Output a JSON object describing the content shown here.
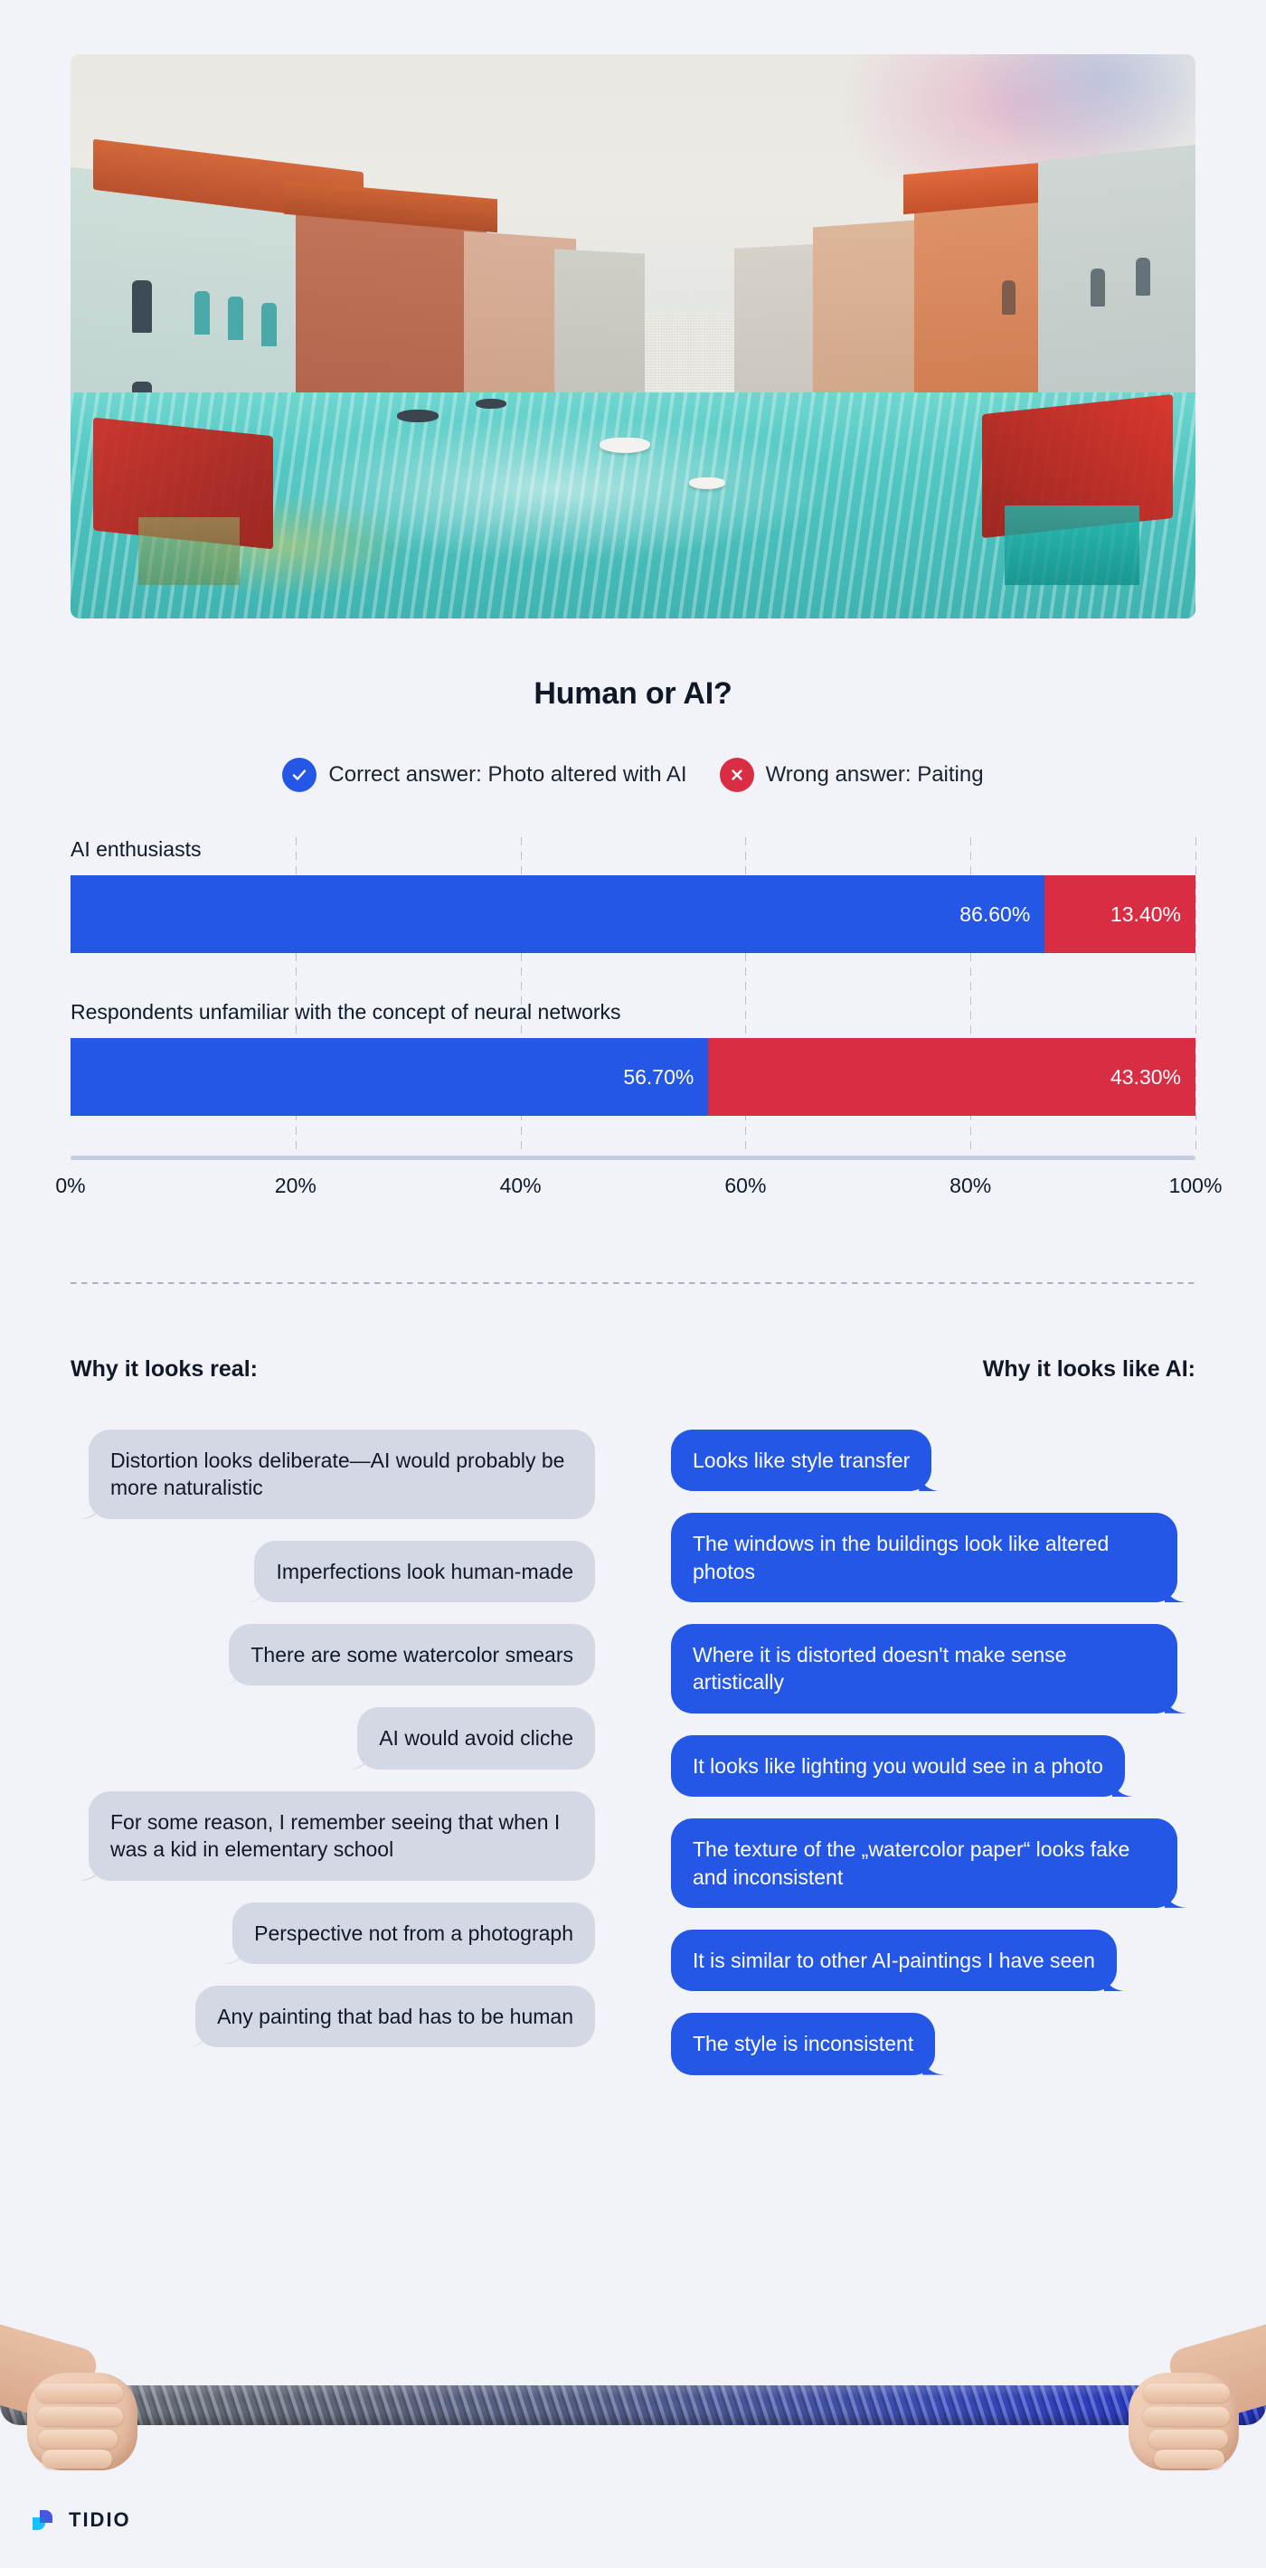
{
  "hero": {
    "alt": "watercolor-painting-of-venice-canal-with-boats"
  },
  "headline": "Human or AI?",
  "legend": [
    {
      "icon": "check-circle-icon",
      "label": "Correct answer: Photo altered with AI",
      "color": "#2457e6"
    },
    {
      "icon": "x-circle-icon",
      "label": "Wrong answer: Paiting",
      "color": "#d92d43"
    }
  ],
  "chart_data": {
    "type": "bar",
    "title": "Human or AI?",
    "orientation": "horizontal",
    "stacked": true,
    "categories": [
      "AI enthusiasts",
      "Respondents unfamiliar with the concept of neural networks"
    ],
    "series": [
      {
        "name": "Correct answer: Photo altered with AI",
        "color": "#2457e6",
        "values": [
          86.6,
          56.7
        ],
        "labels": [
          "86.60%",
          "56.70%"
        ]
      },
      {
        "name": "Wrong answer: Paiting",
        "color": "#d92d43",
        "values": [
          13.4,
          43.3
        ],
        "labels": [
          "13.40%",
          "43.30%"
        ]
      }
    ],
    "xlabel": "",
    "ylabel": "",
    "xlim": [
      0,
      100
    ],
    "xticks": [
      0,
      20,
      40,
      60,
      80,
      100
    ],
    "xtick_labels": [
      "0%",
      "20%",
      "40%",
      "60%",
      "80%",
      "100%"
    ],
    "grid": true,
    "grid_style": "dashed-vertical",
    "legend_position": "top-center"
  },
  "columns": {
    "left": {
      "heading": "Why it looks real:",
      "quotes": [
        "Distortion looks deliberate—AI would probably be more naturalistic",
        "Imperfections look human-made",
        "There are some watercolor smears",
        "AI would avoid cliche",
        "For some reason, I remember seeing that when I was a kid in elementary school",
        "Perspective not from a photograph",
        "Any painting that bad has to be human"
      ]
    },
    "right": {
      "heading": "Why it looks like AI:",
      "quotes": [
        "Looks like style transfer",
        "The windows in the buildings look like altered photos",
        "Where it is distorted doesn't make sense artistically",
        "It looks like lighting you would see in a photo",
        "The texture of the „watercolor paper“ looks fake and inconsistent",
        "It is similar to other AI-paintings I have seen",
        "The style is inconsistent"
      ]
    }
  },
  "footer_illustration": "two-hands-pulling-tug-of-war-rope",
  "logo": {
    "text": "TIDIO",
    "mark": "tidio-chat-bubble-icon"
  }
}
